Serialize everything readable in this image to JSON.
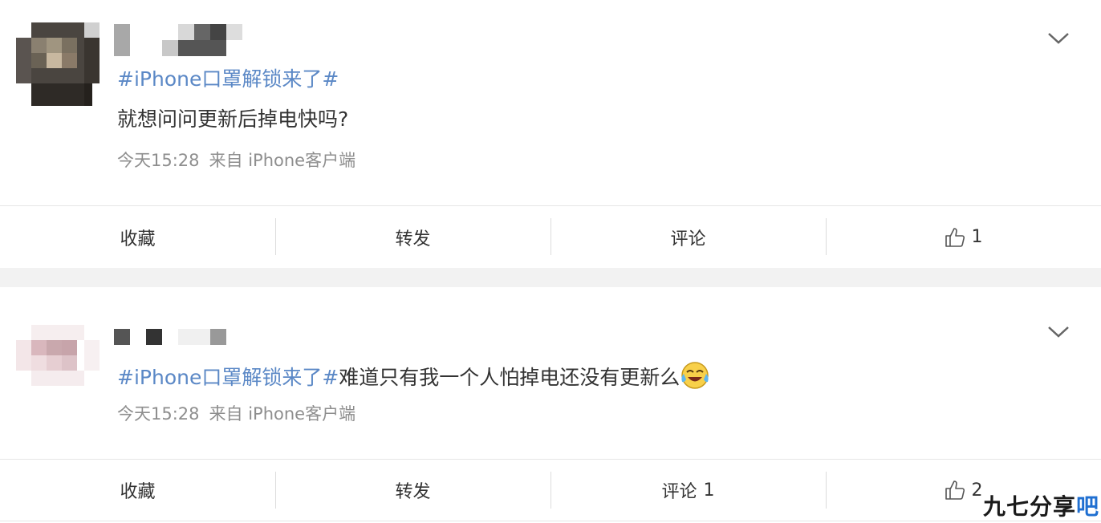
{
  "posts": [
    {
      "topic": "#iPhone口罩解锁来了#",
      "text": "就想问问更新后掉电快吗?",
      "time": "今天15:28",
      "source": "来自 iPhone客户端",
      "actions": {
        "collect": "收藏",
        "repost": "转发",
        "comment": "评论",
        "comment_count": "",
        "like_count": "1"
      }
    },
    {
      "topic": "#iPhone口罩解锁来了#",
      "text": "难道只有我一个人怕掉电还没有更新么",
      "emoji": "crying-laughing-emoji",
      "time": "今天15:28",
      "source": "来自 iPhone客户端",
      "actions": {
        "collect": "收藏",
        "repost": "转发",
        "comment": "评论",
        "comment_count": "1",
        "like_count": "2"
      }
    }
  ],
  "watermark": {
    "main": "九七分享",
    "accent": "吧"
  },
  "colors": {
    "hashtag": "#5b88c6",
    "meta": "#8e8e8e",
    "background": "#f2f2f2"
  }
}
